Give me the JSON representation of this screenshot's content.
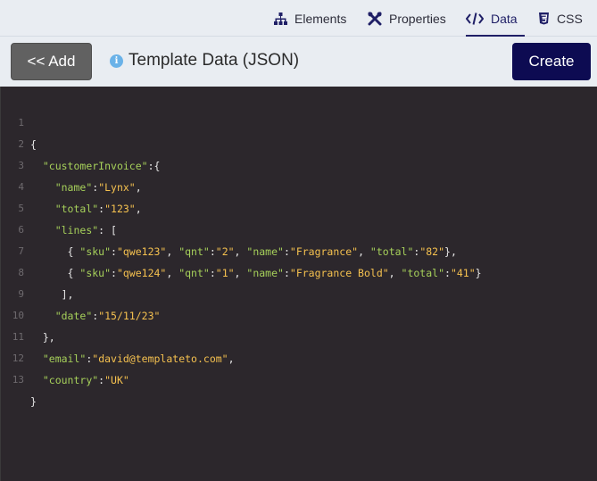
{
  "tabs": {
    "elements": "Elements",
    "properties": "Properties",
    "data": "Data",
    "css": "CSS"
  },
  "toolbar": {
    "add_label": "<< Add",
    "title": "Template Data (JSON)",
    "create_label": "Create"
  },
  "editor": {
    "line_numbers": [
      "1",
      "2",
      "3",
      "4",
      "5",
      "6",
      "7",
      "8",
      "9",
      "10",
      "11",
      "12",
      "13"
    ],
    "tokens": {
      "l1_open": "{",
      "customerInvoice_key": "\"customerInvoice\"",
      "customerInvoice_sep": ":{",
      "name_key": "\"name\"",
      "name_val": "\"Lynx\"",
      "total_key": "\"total\"",
      "total_val": "\"123\"",
      "lines_key": "\"lines\"",
      "lines_sep": ": [",
      "sku_key": "\"sku\"",
      "qnt_key": "\"qnt\"",
      "item1_sku": "\"qwe123\"",
      "item1_qnt": "\"2\"",
      "item1_name": "\"Fragrance\"",
      "item1_total": "\"82\"",
      "item2_sku": "\"qwe124\"",
      "item2_qnt": "\"1\"",
      "item2_name": "\"Fragrance Bold\"",
      "item2_total": "\"41\"",
      "lines_close": "],",
      "date_key": "\"date\"",
      "date_val": "\"15/11/23\"",
      "obj_close": "},",
      "email_key": "\"email\"",
      "email_val": "\"david@templateto.com\"",
      "country_key": "\"country\"",
      "country_val": "\"UK\"",
      "root_close": "}"
    }
  },
  "colors": {
    "accent": "#1f1f66",
    "create_button": "#0d0b52",
    "add_button": "#616161",
    "editor_bg": "#2c272c",
    "json_key": "#a6d05a",
    "json_string": "#f5c14f",
    "info_icon": "#6ab2e8"
  }
}
